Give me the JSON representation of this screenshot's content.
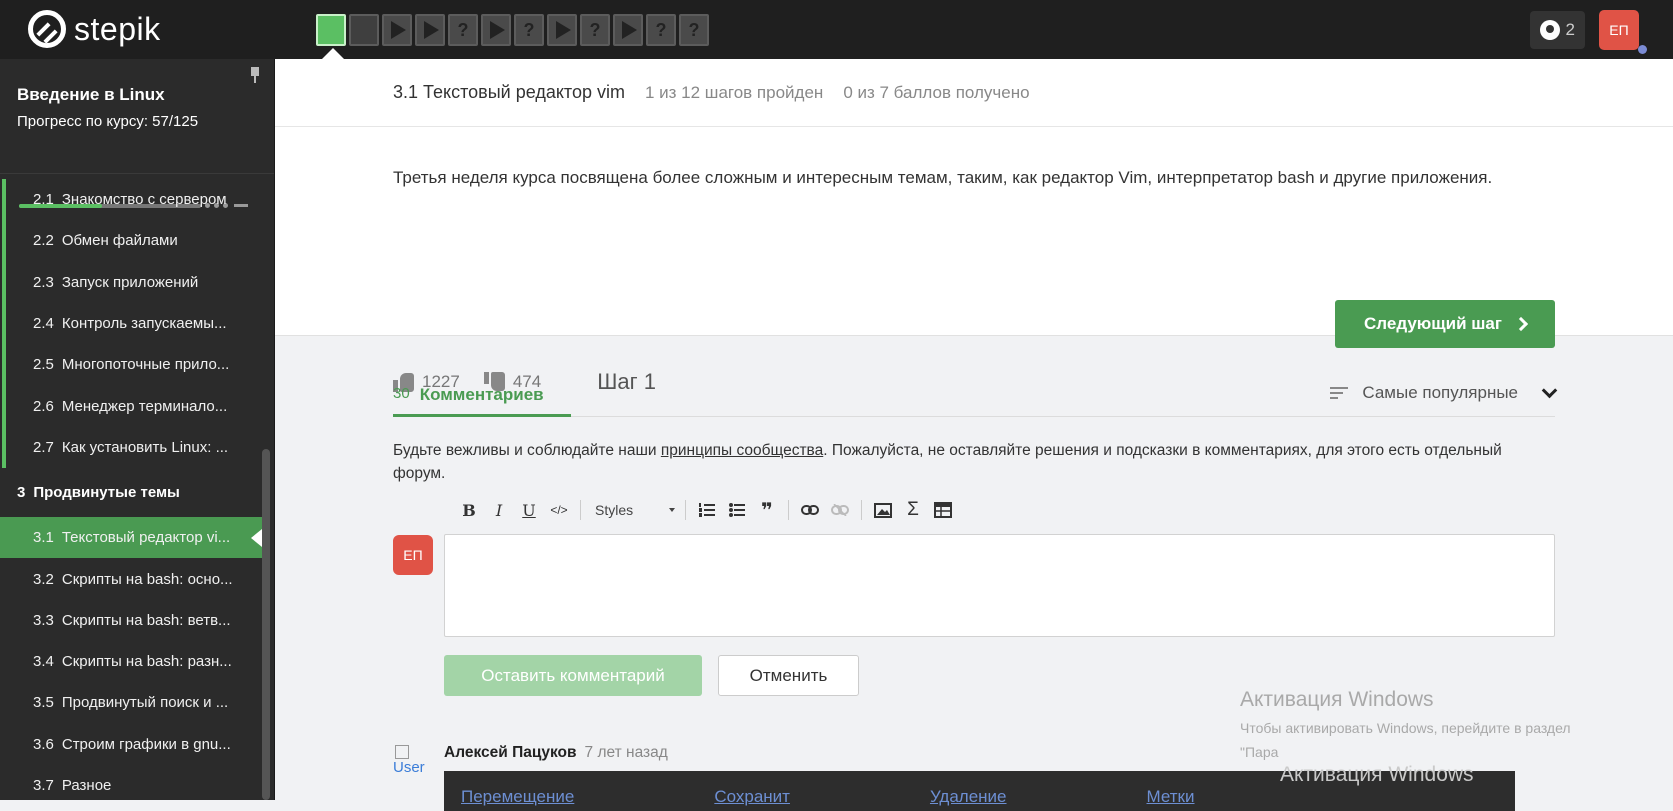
{
  "topbar": {
    "logo_text": "stepik",
    "steps": [
      "",
      "",
      "",
      "",
      "?",
      "",
      "?",
      "",
      "?",
      "",
      "?",
      "?"
    ],
    "notifications_count": "2",
    "user_initials": "ЕП"
  },
  "sidebar": {
    "course_title": "Введение в Linux",
    "progress_text": "Прогресс по курсу:  57/125",
    "progress_fraction": 0.456,
    "lessons_before": [
      {
        "num": "2.1",
        "title": "Знакомство с сервером"
      },
      {
        "num": "2.2",
        "title": "Обмен файлами"
      },
      {
        "num": "2.3",
        "title": "Запуск приложений"
      },
      {
        "num": "2.4",
        "title": "Контроль запускаемы..."
      },
      {
        "num": "2.5",
        "title": "Многопоточные прило..."
      },
      {
        "num": "2.6",
        "title": "Менеджер терминало..."
      },
      {
        "num": "2.7",
        "title": "Как установить Linux: ..."
      }
    ],
    "section": {
      "num": "3",
      "title": "Продвинутые темы"
    },
    "lessons_after": [
      {
        "num": "3.1",
        "title": "Текстовый редактор vi..."
      },
      {
        "num": "3.2",
        "title": "Скрипты на bash: осно..."
      },
      {
        "num": "3.3",
        "title": "Скрипты на bash: ветв..."
      },
      {
        "num": "3.4",
        "title": "Скрипты на bash: разн..."
      },
      {
        "num": "3.5",
        "title": "Продвинутый поиск и ..."
      },
      {
        "num": "3.6",
        "title": "Строим графики в gnu..."
      },
      {
        "num": "3.7",
        "title": "Разное"
      }
    ]
  },
  "header": {
    "lesson_title": "3.1 Текстовый редактор vim",
    "steps_passed": "1 из 12 шагов пройден",
    "points": "0 из 7 баллов  получено"
  },
  "step": {
    "text": "Третья неделя курса посвящена более сложным и интересным темам, таким, как редактор Vim, интерпретатор bash и другие приложения.",
    "likes": "1227",
    "dislikes": "474",
    "step_label": "Шаг 1",
    "next_button": "Следующий шаг"
  },
  "comments": {
    "count": "30",
    "tab_label": "Комментариев",
    "sort_label": "Самые популярные",
    "rules_before": "Будьте вежливы и соблюдайте наши ",
    "rules_link": "принципы сообщества",
    "rules_after": ". Пожалуйста, не оставляйте решения и подсказки в комментариях, для этого есть отдельный форум.",
    "toolbar": {
      "bold": "B",
      "italic": "I",
      "underline": "U",
      "code": "</>",
      "styles": "Styles",
      "quote": "❞",
      "sigma": "Σ"
    },
    "avatar_initials": "ЕП",
    "submit_label": "Оставить комментарий",
    "cancel_label": "Отменить",
    "first_comment": {
      "user_alt": "User",
      "author": "Алексей Пацуков",
      "time": "7 лет назад",
      "table_headers": [
        "Перемещение",
        "Сохранит",
        "Удаление",
        "Метки"
      ]
    }
  },
  "watermark": {
    "title": "Активация Windows",
    "subtitle": "Чтобы активировать Windows, перейдите в раздел",
    "subtitle2": "\"Пара",
    "title2": "Активация Windows"
  }
}
